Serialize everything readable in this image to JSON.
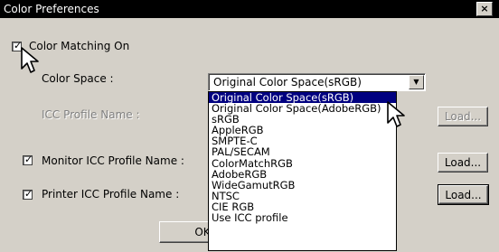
{
  "window": {
    "title": "Color Preferences",
    "close_label": "×"
  },
  "color_matching": {
    "label": "Color Matching On",
    "checked": true
  },
  "color_space": {
    "label": "Color Space :",
    "selected": "Original Color Space(sRGB)",
    "options": [
      "Original Color Space(sRGB)",
      "Original Color Space(AdobeRGB)",
      "sRGB",
      "AppleRGB",
      "SMPTE-C",
      "PAL/SECAM",
      "ColorMatchRGB",
      "AdobeRGB",
      "WideGamutRGB",
      "NTSC",
      "CIE RGB",
      "Use ICC profile"
    ],
    "highlighted_index": 0
  },
  "icc_profile": {
    "label": "ICC Profile Name :",
    "load_label": "Load..."
  },
  "monitor_icc": {
    "label": "Monitor ICC Profile Name :",
    "checked": true,
    "load_label": "Load..."
  },
  "printer_icc": {
    "label": "Printer ICC Profile Name :",
    "checked": true,
    "load_label": "Load..."
  },
  "ok_button": {
    "label": "OK"
  },
  "check_glyph": "✓",
  "colors": {
    "title_bar": "#000000",
    "selection": "#000080",
    "dialog_bg": "#d4d0c8"
  },
  "icons": {
    "close": "close-icon",
    "dropdown": "chevron-down-icon",
    "pointer": "arrow-cursor-icon"
  }
}
